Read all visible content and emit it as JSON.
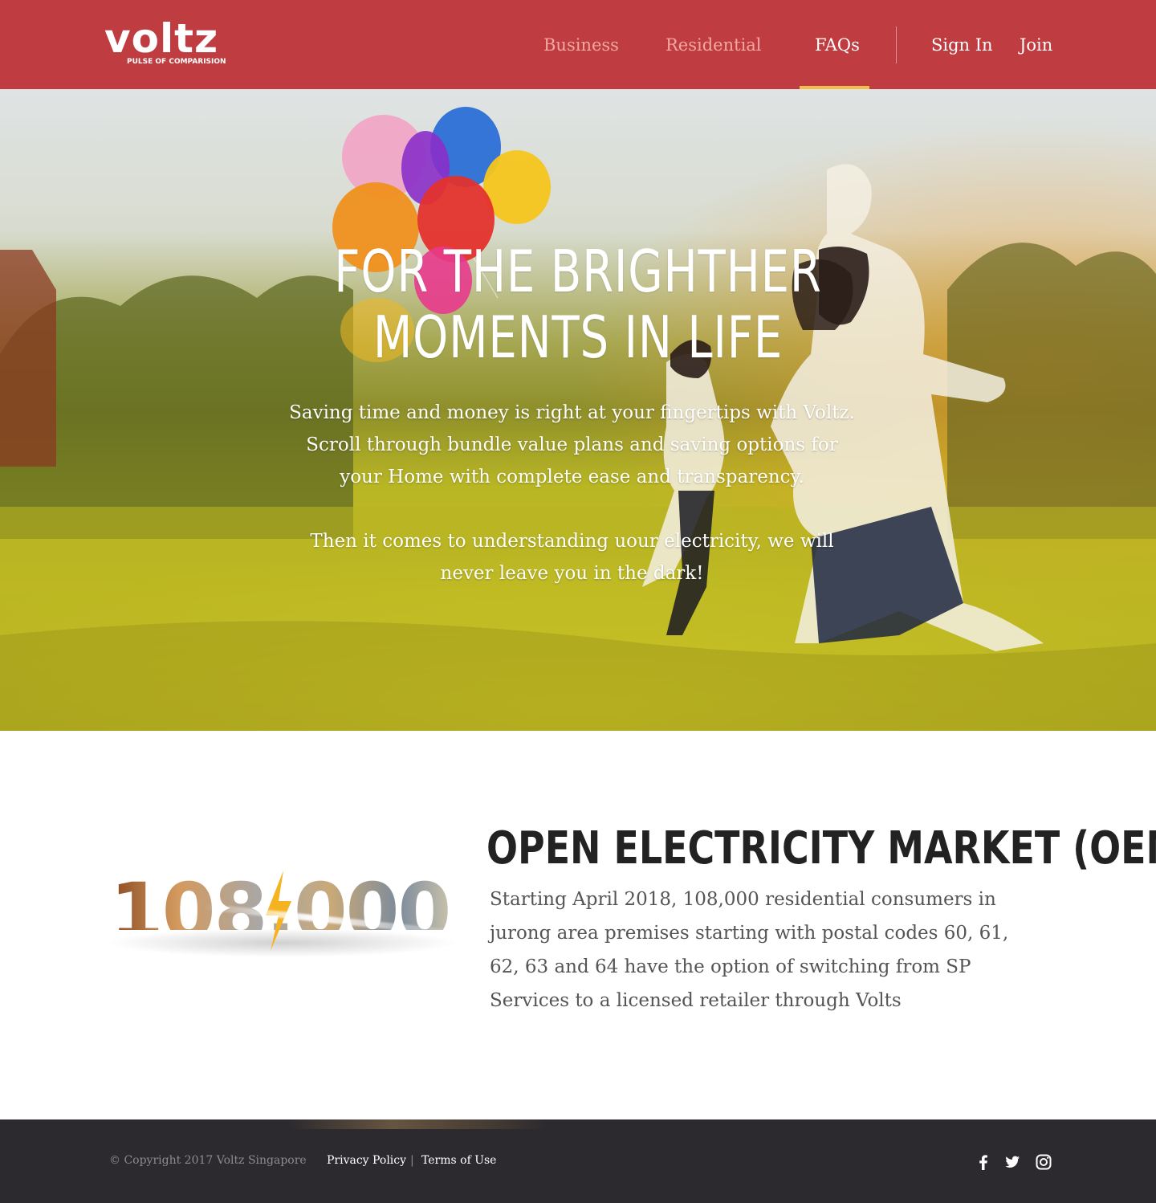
{
  "header": {
    "logo": {
      "wordmark": "voltz",
      "tagline": "PULSE OF COMPARISION"
    },
    "nav": {
      "business": "Business",
      "residential": "Residential",
      "faqs": "FAQs",
      "active": "FAQs",
      "sign_in": "Sign In",
      "join": "Join"
    }
  },
  "hero": {
    "title_line1": "FOR THE BRIGHTHER",
    "title_line2": "MOMENTS IN LIFE",
    "paragraph1": "Saving time and money is right at your fingertips with Voltz. Scroll through bundle value plans and saving options for your Home with complete ease and transparency.",
    "paragraph2": "Then it comes to understanding uour electricity, we will never leave you in the dark!"
  },
  "oem": {
    "figure": "108,000",
    "title": "OPEN ELECTRICITY MARKET (OEM)",
    "body": "Starting April 2018, 108,000 residential consumers in jurong area premises starting with postal codes 60, 61, 62, 63 and 64 have the option of switching from SP Services to a licensed retailer through Volts"
  },
  "footer": {
    "copyright": "© Copyright 2017 Voltz Singapore",
    "privacy": "Privacy Policy",
    "separator": "|",
    "terms": "Terms of Use",
    "social": [
      "facebook-icon",
      "twitter-icon",
      "instagram-icon"
    ]
  },
  "colors": {
    "brand": "#bf3d41",
    "nav_muted": "#f3a7a1",
    "accent": "#f2c04a",
    "footer_bg": "#2c2a2e",
    "heading": "#222222",
    "body_text": "#555555"
  }
}
